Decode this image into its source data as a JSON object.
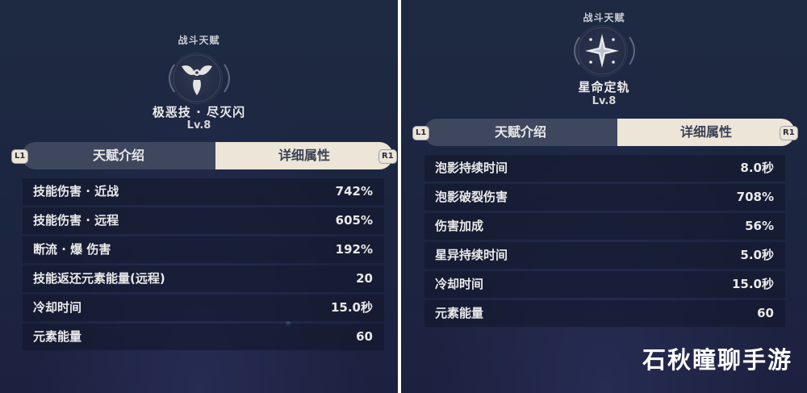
{
  "left": {
    "section_label": "战斗天赋",
    "icon": "triple-drop-icon",
    "skill_name": "极恶技 · 尽灭闪",
    "level": "Lv.8",
    "key_left": "L1",
    "key_right": "R1",
    "tab_intro": "天赋介绍",
    "tab_detail": "详细属性",
    "rows": [
      {
        "label": "技能伤害 · 近战",
        "value": "742%"
      },
      {
        "label": "技能伤害 · 远程",
        "value": "605%"
      },
      {
        "label": "断流 · 爆 伤害",
        "value": "192%"
      },
      {
        "label": "技能返还元素能量(远程)",
        "value": "20"
      },
      {
        "label": "冷却时间",
        "value": "15.0秒"
      },
      {
        "label": "元素能量",
        "value": "60"
      }
    ]
  },
  "right": {
    "section_label": "战斗天赋",
    "icon": "star-compass-icon",
    "skill_name": "星命定轨",
    "level": "Lv.8",
    "key_left": "L1",
    "key_right": "R1",
    "tab_intro": "天赋介绍",
    "tab_detail": "详细属性",
    "rows": [
      {
        "label": "泡影持续时间",
        "value": "8.0秒"
      },
      {
        "label": "泡影破裂伤害",
        "value": "708%"
      },
      {
        "label": "伤害加成",
        "value": "56%"
      },
      {
        "label": "星异持续时间",
        "value": "5.0秒"
      },
      {
        "label": "冷却时间",
        "value": "15.0秒"
      },
      {
        "label": "元素能量",
        "value": "60"
      }
    ]
  },
  "watermark": "石秋瞳聊手游",
  "colors": {
    "background": "#1e2a42",
    "tab_inactive": "#3f475f",
    "tab_active": "#ece5d8",
    "row_bg": "#101628",
    "text": "#e9e9e9"
  }
}
